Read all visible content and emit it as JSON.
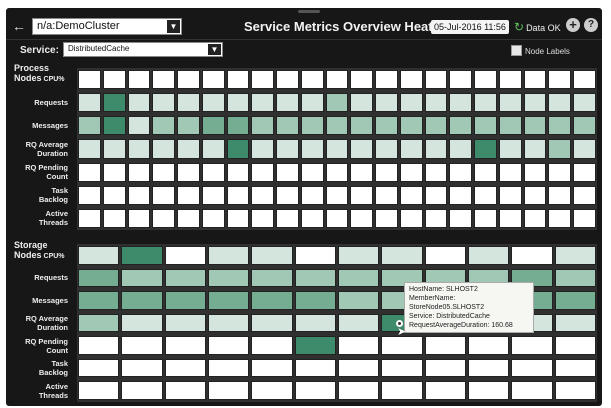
{
  "header": {
    "cluster": "n/a:DemoCluster",
    "title": "Service Metrics Overview Heatmap",
    "timestamp": "05-Jul-2016 11:56",
    "status": "Data OK",
    "icons": [
      "back-arrow-icon",
      "chevron-down-icon",
      "refresh-icon",
      "plus-icon",
      "help-icon"
    ]
  },
  "service": {
    "label": "Service:",
    "selected": "DistributedCache"
  },
  "node_labels": {
    "label": "Node Labels",
    "checked": false
  },
  "process": {
    "title": "Process",
    "title2": "Nodes",
    "cpu_label": "CPU%",
    "rows": [
      {
        "l1": "Requests",
        "l2": "",
        "values": [
          1,
          4,
          1,
          1,
          1,
          1,
          1,
          1,
          1,
          1,
          2,
          1,
          1,
          1,
          1,
          1,
          1,
          1,
          1,
          1,
          1
        ]
      },
      {
        "l1": "Messages",
        "l2": "",
        "values": [
          2,
          4,
          1,
          2,
          2,
          3,
          3,
          2,
          2,
          2,
          2,
          2,
          2,
          2,
          2,
          2,
          2,
          2,
          2,
          2,
          2
        ]
      },
      {
        "l1": "RQ Average",
        "l2": "Duration",
        "values": [
          1,
          1,
          1,
          1,
          1,
          1,
          4,
          1,
          1,
          1,
          1,
          1,
          1,
          1,
          1,
          1,
          4,
          1,
          1,
          2,
          1
        ]
      },
      {
        "l1": "RQ Pending",
        "l2": "Count",
        "values": [
          0,
          0,
          0,
          0,
          0,
          0,
          0,
          0,
          0,
          0,
          0,
          0,
          0,
          0,
          0,
          0,
          0,
          0,
          0,
          0,
          0
        ]
      },
      {
        "l1": "Task",
        "l2": "Backlog",
        "values": [
          0,
          0,
          0,
          0,
          0,
          0,
          0,
          0,
          0,
          0,
          0,
          0,
          0,
          0,
          0,
          0,
          0,
          0,
          0,
          0,
          0
        ]
      },
      {
        "l1": "Active",
        "l2": "Threads",
        "values": [
          0,
          0,
          0,
          0,
          0,
          0,
          0,
          0,
          0,
          0,
          0,
          0,
          0,
          0,
          0,
          0,
          0,
          0,
          0,
          0,
          0
        ]
      }
    ],
    "cpu_values": [
      0,
      0,
      0,
      0,
      0,
      0,
      0,
      0,
      0,
      0,
      0,
      0,
      0,
      0,
      0,
      0,
      0,
      0,
      0,
      0,
      0
    ]
  },
  "storage": {
    "title": "Storage",
    "title2": "Nodes",
    "cpu_label": "CPU%",
    "cpu_values": [
      1,
      4,
      0,
      1,
      1,
      0,
      1,
      1,
      0,
      1,
      0,
      1
    ],
    "rows": [
      {
        "l1": "Requests",
        "l2": "",
        "values": [
          3,
          2,
          2,
          2,
          2,
          2,
          2,
          2,
          2,
          2,
          3,
          2
        ]
      },
      {
        "l1": "Messages",
        "l2": "",
        "values": [
          3,
          3,
          3,
          3,
          3,
          3,
          2,
          2,
          2,
          2,
          3,
          3
        ]
      },
      {
        "l1": "RQ Average",
        "l2": "Duration",
        "values": [
          2,
          1,
          1,
          1,
          1,
          1,
          1,
          4,
          1,
          1,
          1,
          1
        ]
      },
      {
        "l1": "RQ Pending",
        "l2": "Count",
        "values": [
          0,
          0,
          0,
          0,
          0,
          4,
          0,
          0,
          0,
          0,
          0,
          0
        ]
      },
      {
        "l1": "Task",
        "l2": "Backlog",
        "values": [
          0,
          0,
          0,
          0,
          0,
          0,
          0,
          0,
          0,
          0,
          0,
          0
        ]
      },
      {
        "l1": "Active",
        "l2": "Threads",
        "values": [
          0,
          0,
          0,
          0,
          0,
          0,
          0,
          0,
          0,
          0,
          0,
          0
        ]
      }
    ]
  },
  "tooltip": {
    "host": "HostName: SLHOST2",
    "member": "MemberName: StoreNode05.SLHOST2",
    "service": "Service: DistributedCache",
    "metric": "RequestAverageDuration: 160.68"
  }
}
